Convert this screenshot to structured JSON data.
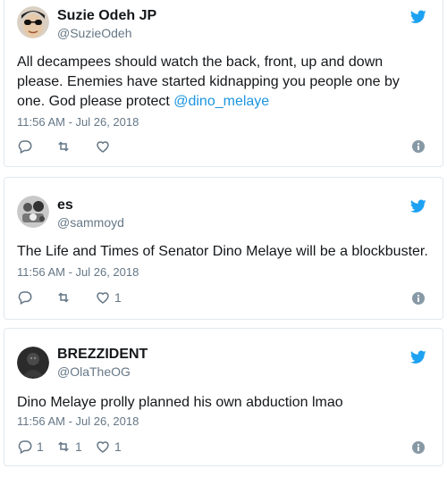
{
  "colors": {
    "accent": "#1da1f2",
    "mention": "#1b95e0",
    "muted": "#657786",
    "border": "#e1e8ed"
  },
  "tweets": [
    {
      "name": "Suzie Odeh JP",
      "handle": "@SuzieOdeh",
      "text_before": "All decampees should watch the back, front, up and down please. Enemies have started kidnapping you people one by one. God please protect ",
      "mention": "@dino_melaye",
      "text_after": "",
      "timestamp": "11:56 AM - Jul 26, 2018",
      "reply_count": "",
      "retweet_count": "",
      "like_count": ""
    },
    {
      "name": "es",
      "handle": "@sammoyd",
      "text_before": "The Life and Times of Senator Dino Melaye will be a blockbuster.",
      "mention": "",
      "text_after": "",
      "timestamp": "11:56 AM - Jul 26, 2018",
      "reply_count": "",
      "retweet_count": "",
      "like_count": "1"
    },
    {
      "name": "BREZZIDENT",
      "handle": "@OlaTheOG",
      "text_before": "Dino Melaye prolly planned his own abduction lmao",
      "mention": "",
      "text_after": "",
      "timestamp": "11:56 AM - Jul 26, 2018",
      "reply_count": "1",
      "retweet_count": "1",
      "like_count": "1"
    }
  ]
}
